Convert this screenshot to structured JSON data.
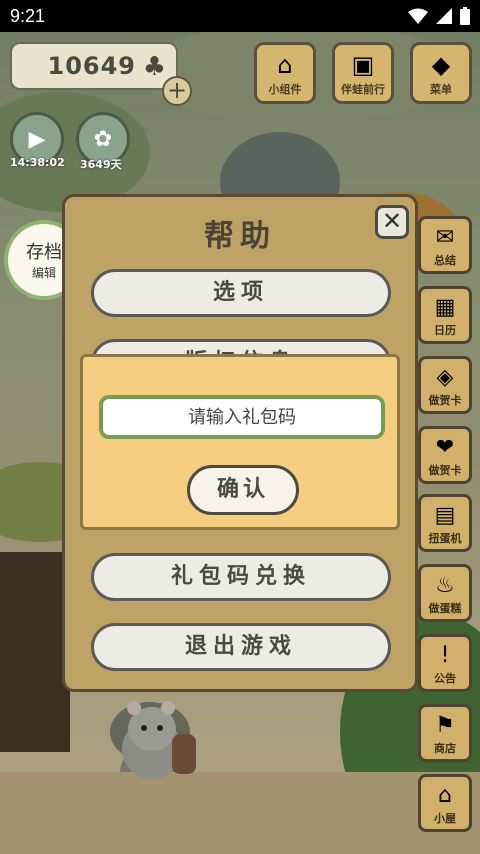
{
  "status_bar": {
    "time": "9:21"
  },
  "hud": {
    "coins": "10649",
    "timer_label": "14:38:02",
    "days_label": "3649天"
  },
  "top_menu": [
    {
      "label": "小组件",
      "icon": "widget-icon"
    },
    {
      "label": "伴蛙前行",
      "icon": "frog-journey-icon"
    },
    {
      "label": "菜单",
      "icon": "menu-icon"
    }
  ],
  "side_menu": [
    {
      "label": "总结",
      "icon": "envelope-icon"
    },
    {
      "label": "日历",
      "icon": "calendar-icon"
    },
    {
      "label": "做贺卡",
      "icon": "card-icon"
    },
    {
      "label": "做贺卡",
      "icon": "card2-icon"
    },
    {
      "label": "扭蛋机",
      "icon": "capsule-machine-icon"
    },
    {
      "label": "做蛋糕",
      "icon": "cake-icon"
    },
    {
      "label": "公告",
      "icon": "notice-icon"
    },
    {
      "label": "商店",
      "icon": "shop-icon"
    },
    {
      "label": "小屋",
      "icon": "house-icon"
    }
  ],
  "save_button": {
    "main": "存档",
    "sub": "编辑"
  },
  "help_dialog": {
    "title": "帮助",
    "close": "✕",
    "options": [
      "选项",
      "版权信息",
      "礼包码兑换",
      "退出游戏"
    ]
  },
  "gift_dialog": {
    "placeholder": "请输入礼包码",
    "confirm": "确认"
  },
  "colors": {
    "panel": "#bfa366",
    "dialog": "#f4cd81",
    "accent_green": "#7a9a58"
  }
}
